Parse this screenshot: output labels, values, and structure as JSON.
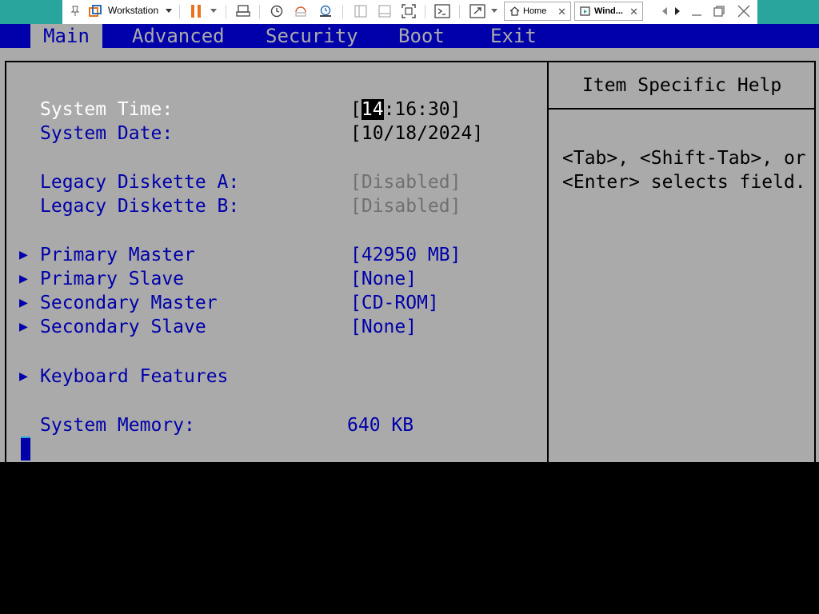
{
  "toolbar": {
    "vm_library_label": "Workstation",
    "icons": [
      "pin-icon",
      "vmware-logo-icon",
      "pause-icon",
      "send-ctrl-alt-del-icon",
      "snapshot-icon",
      "revert-snapshot-icon",
      "snapshot-manager-icon",
      "library-view-icon",
      "thumbnail-view-icon",
      "fullscreen-icon",
      "console-view-icon",
      "stretch-icon"
    ],
    "accent_color": "#2aa59e",
    "pause_color": "#e8731e"
  },
  "tabs": [
    {
      "label": "Home"
    },
    {
      "label": "Wind..."
    }
  ],
  "bios": {
    "menus": [
      "Main",
      "Advanced",
      "Security",
      "Boot",
      "Exit"
    ],
    "active_menu": "Main",
    "items": {
      "system_time": {
        "label": "System Time:",
        "value_prefix": "[",
        "value_hl": "14",
        "value_rest": ":16:30]"
      },
      "system_date": {
        "label": "System Date:",
        "value": "[10/18/2024]"
      },
      "diskette_a": {
        "label": "Legacy Diskette A:",
        "value": "[Disabled]"
      },
      "diskette_b": {
        "label": "Legacy Diskette B:",
        "value": "[Disabled]"
      },
      "primary_master": {
        "label": "Primary Master",
        "value": "[42950 MB]"
      },
      "primary_slave": {
        "label": "Primary Slave",
        "value": "[None]"
      },
      "secondary_master": {
        "label": "Secondary Master",
        "value": "[CD-ROM]"
      },
      "secondary_slave": {
        "label": "Secondary Slave",
        "value": "[None]"
      },
      "keyboard_features": {
        "label": "Keyboard Features"
      },
      "system_memory": {
        "label": "System Memory:",
        "value": "640 KB"
      }
    },
    "submenu_arrow": "▶",
    "help": {
      "title": "Item Specific Help",
      "line1": "<Tab>, <Shift-Tab>, or",
      "line2": "<Enter> selects field."
    },
    "colors": {
      "background": "#aaaaaa",
      "menubar": "#0000aa",
      "label": "#0000aa",
      "selected_label": "#ffffff",
      "disabled": "#707070"
    }
  }
}
